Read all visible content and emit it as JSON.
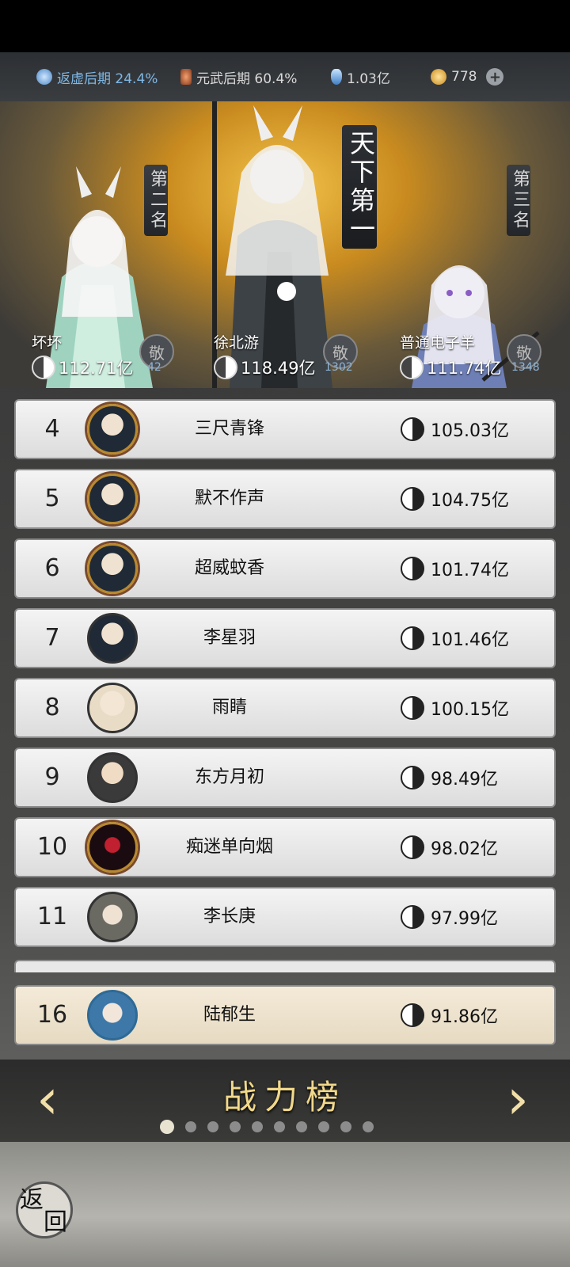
{
  "status": {
    "realm1": "返虚后期 24.4%",
    "realm2": "元武后期 60.4%",
    "spirit": "1.03亿",
    "coins": "778"
  },
  "podium": {
    "first": {
      "banner": "天下第一",
      "name": "徐北游",
      "power": "118.49亿",
      "respect_label": "敬",
      "respect_count": "1302"
    },
    "second": {
      "banner": "第二名",
      "name": "坏坏",
      "power": "112.71亿",
      "respect_label": "敬",
      "respect_count": "42"
    },
    "third": {
      "banner": "第三名",
      "name": "普通电子羊",
      "power": "111.74亿",
      "respect_label": "敬",
      "respect_count": "1348"
    }
  },
  "rankings": [
    {
      "rank": "4",
      "name": "三尺青锋",
      "power": "105.03亿"
    },
    {
      "rank": "5",
      "name": "默不作声",
      "power": "104.75亿"
    },
    {
      "rank": "6",
      "name": "超威蚊香",
      "power": "101.74亿"
    },
    {
      "rank": "7",
      "name": "李星羽",
      "power": "101.46亿"
    },
    {
      "rank": "8",
      "name": "雨睛",
      "power": "100.15亿"
    },
    {
      "rank": "9",
      "name": "东方月初",
      "power": "98.49亿"
    },
    {
      "rank": "10",
      "name": "痴迷单向烟",
      "power": "98.02亿"
    },
    {
      "rank": "11",
      "name": "李长庚",
      "power": "97.99亿"
    }
  ],
  "self_row": {
    "rank": "16",
    "name": "陆郁生",
    "power": "91.86亿"
  },
  "nav": {
    "title": "战力榜",
    "prev": "‹",
    "next": "›",
    "page_count": 10,
    "active_page": 1
  },
  "footer": {
    "back_label_1": "返",
    "back_label_2": "回"
  },
  "icons": {
    "plus": "+"
  }
}
